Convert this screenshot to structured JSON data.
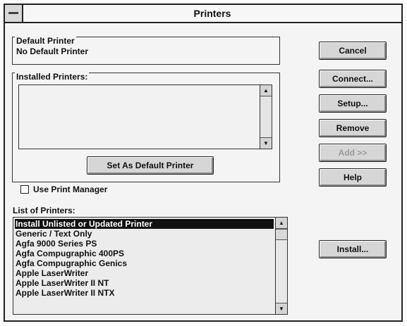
{
  "window": {
    "title": "Printers"
  },
  "default_printer": {
    "group_label": "Default Printer",
    "value": "No Default Printer"
  },
  "installed": {
    "group_label": "Installed Printers:",
    "items": [],
    "set_default_button": "Set As Default Printer"
  },
  "use_print_manager": {
    "label": "Use Print Manager",
    "checked": false
  },
  "list_of_printers": {
    "label": "List of Printers:",
    "items": [
      "Install Unlisted or Updated Printer",
      "Generic / Text Only",
      "Agfa 9000 Series PS",
      "Agfa Compugraphic 400PS",
      "Agfa Compugraphic Genics",
      "Apple LaserWriter",
      "Apple LaserWriter II NT",
      "Apple LaserWriter II NTX"
    ],
    "selected": "Install Unlisted or Updated Printer"
  },
  "buttons": {
    "cancel": "Cancel",
    "connect": "Connect...",
    "setup": "Setup...",
    "remove": "Remove",
    "add": "Add >>",
    "help": "Help",
    "install": "Install..."
  },
  "icons": {
    "scroll_up": "up-arrow-icon",
    "scroll_down": "down-arrow-icon"
  }
}
